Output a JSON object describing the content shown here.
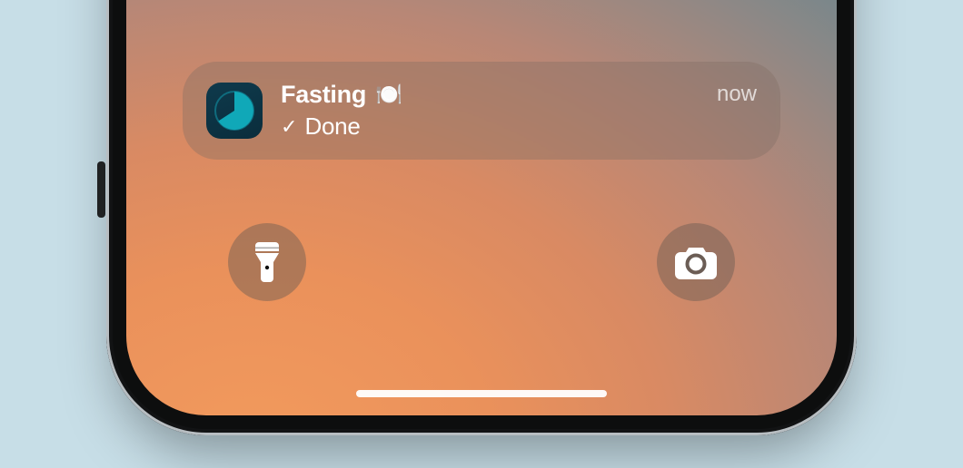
{
  "notification": {
    "app_name": "Fasting",
    "emoji": "🍽️",
    "body": "Done",
    "check": "✓",
    "timestamp": "now"
  },
  "icons": {
    "app_icon": "pie-timer-icon",
    "flashlight": "flashlight-icon",
    "camera": "camera-icon",
    "plate": "plate-emoji",
    "check": "check-icon"
  },
  "colors": {
    "page_bg": "#c7dee7",
    "notification_bg": "rgba(130,110,100,0.38)",
    "text": "#ffffff",
    "app_icon_bg": "#0f3a4c",
    "pie_fill": "#10a8b8",
    "pie_ring": "#0f6c7e"
  }
}
